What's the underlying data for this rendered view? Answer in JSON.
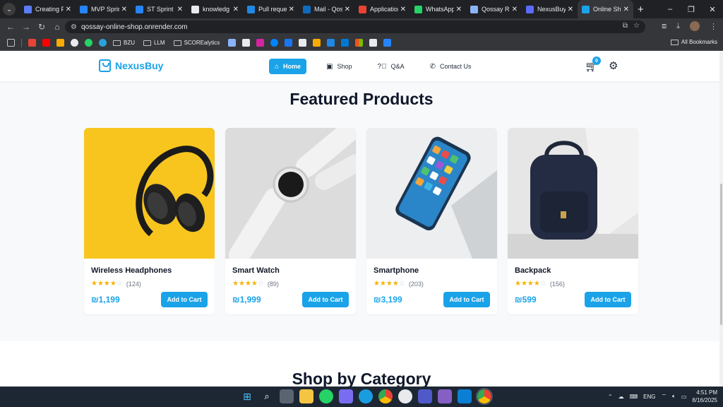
{
  "browser": {
    "tabs": [
      {
        "title": "Creating P",
        "color": "#5b7cfa"
      },
      {
        "title": "MVP Sprin",
        "color": "#2684ff"
      },
      {
        "title": "ST Sprint",
        "color": "#2684ff"
      },
      {
        "title": "knowledg",
        "color": "#e8eaed"
      },
      {
        "title": "Pull reque",
        "color": "#1e88e5"
      },
      {
        "title": "Mail - Qos",
        "color": "#0f6cbd"
      },
      {
        "title": "Application",
        "color": "#ea4335"
      },
      {
        "title": "WhatsApp",
        "color": "#25d366"
      },
      {
        "title": "Qossay Ri",
        "color": "#8ab4f8"
      },
      {
        "title": "NexusBuy",
        "color": "#5b6cff"
      },
      {
        "title": "Online Sh",
        "color": "#1aa3e8"
      }
    ],
    "active_tab_index": 10,
    "url": "qossay-online-shop.onrender.com",
    "bookmarks_folders": [
      "BZU",
      "LLM",
      "SCOREalytics"
    ],
    "all_bookmarks": "All Bookmarks"
  },
  "site": {
    "logo": "NexusBuy",
    "nav": [
      {
        "label": "Home",
        "icon": "home-icon"
      },
      {
        "label": "Shop",
        "icon": "shopping-bag-icon"
      },
      {
        "label": "Q&A",
        "icon": "question-icon"
      },
      {
        "label": "Contact Us",
        "icon": "phone-icon"
      }
    ],
    "cart_count": "0",
    "accent": "#1aa3e8"
  },
  "featured": {
    "title": "Featured Products",
    "products": [
      {
        "name": "Wireless Headphones",
        "rating": 4,
        "reviews": "(124)",
        "price": "₪1,199",
        "button": "Add to Cart"
      },
      {
        "name": "Smart Watch",
        "rating": 4,
        "reviews": "(89)",
        "price": "₪1,999",
        "button": "Add to Cart"
      },
      {
        "name": "Smartphone",
        "rating": 4,
        "reviews": "(203)",
        "price": "₪3,199",
        "button": "Add to Cart"
      },
      {
        "name": "Backpack",
        "rating": 4,
        "reviews": "(156)",
        "price": "₪599",
        "button": "Add to Cart"
      }
    ]
  },
  "category": {
    "title": "Shop by Category"
  },
  "taskbar": {
    "language": "ENG",
    "time": "4:51 PM",
    "date": "8/16/2025"
  }
}
